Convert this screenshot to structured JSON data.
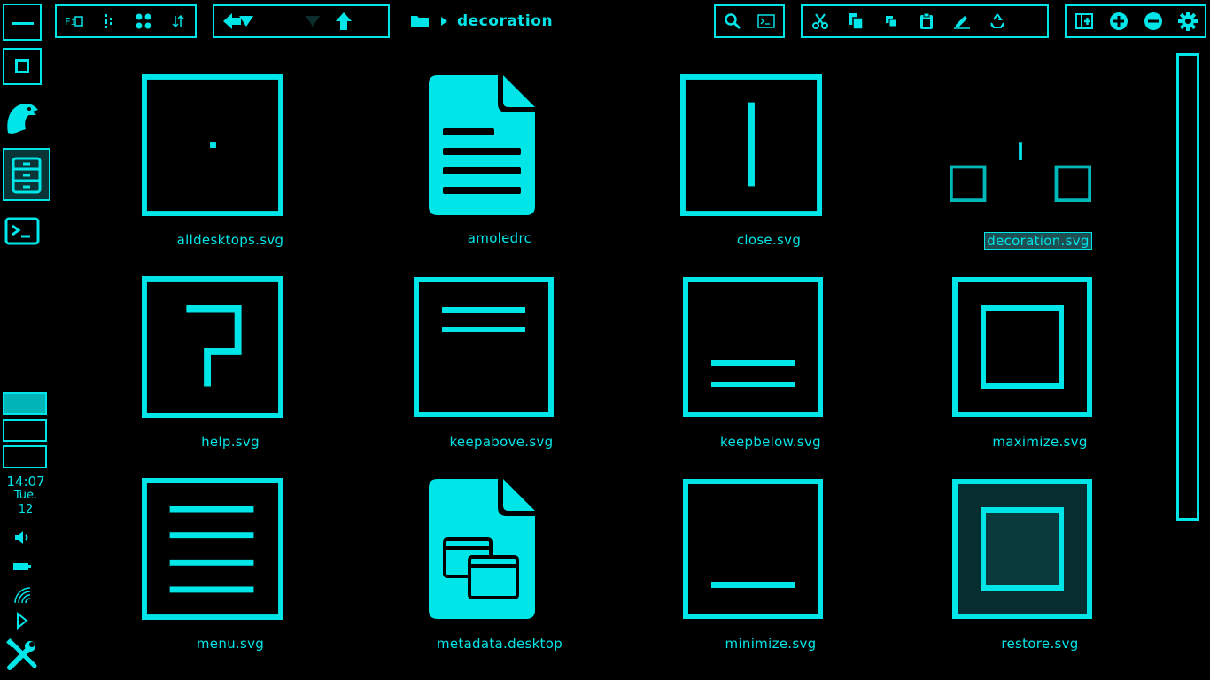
{
  "path": {
    "current_folder": "decoration"
  },
  "clock": {
    "time": "14:07",
    "day": "Tue.",
    "date": "12"
  },
  "files": [
    {
      "name": "alldesktops.svg"
    },
    {
      "name": "amoledrc"
    },
    {
      "name": "close.svg"
    },
    {
      "name": "decoration.svg",
      "selected": true
    },
    {
      "name": "help.svg"
    },
    {
      "name": "keepabove.svg"
    },
    {
      "name": "keepbelow.svg"
    },
    {
      "name": "maximize.svg"
    },
    {
      "name": "menu.svg"
    },
    {
      "name": "metadata.desktop"
    },
    {
      "name": "minimize.svg"
    },
    {
      "name": "restore.svg"
    }
  ],
  "colors": {
    "accent": "#00e5e8",
    "background": "#000000",
    "selected_bg": "#1f4e52"
  }
}
